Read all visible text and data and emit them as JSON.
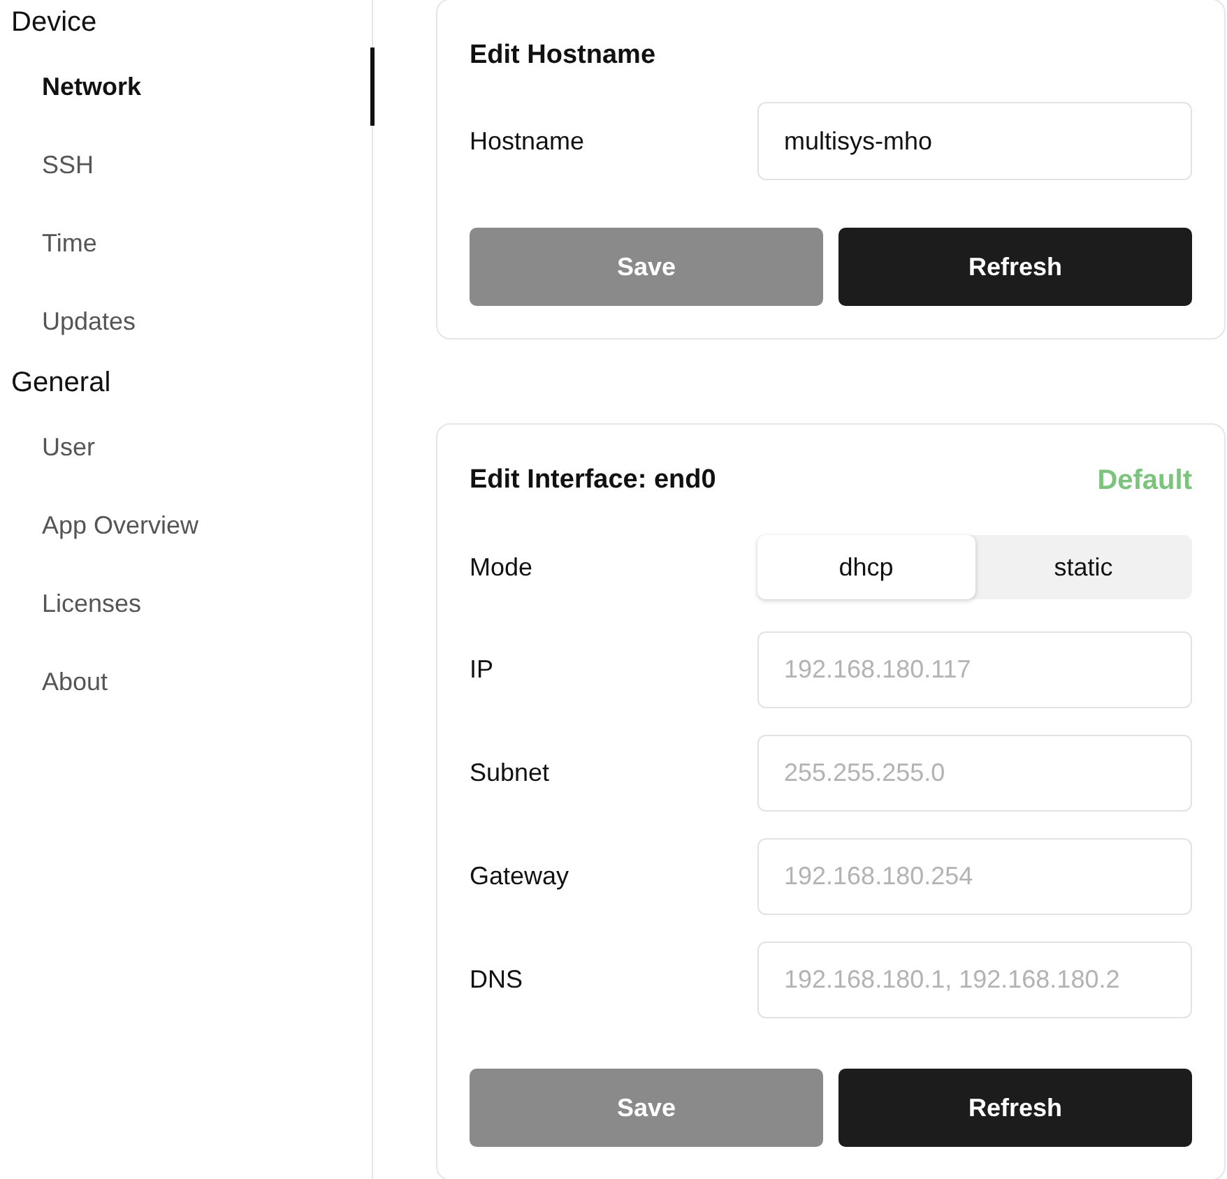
{
  "sidebar": {
    "groups": [
      {
        "title": "Device",
        "items": [
          {
            "label": "Network",
            "selected": true
          },
          {
            "label": "SSH",
            "selected": false
          },
          {
            "label": "Time",
            "selected": false
          },
          {
            "label": "Updates",
            "selected": false
          }
        ]
      },
      {
        "title": "General",
        "items": [
          {
            "label": "User",
            "selected": false
          },
          {
            "label": "App Overview",
            "selected": false
          },
          {
            "label": "Licenses",
            "selected": false
          },
          {
            "label": "About",
            "selected": false
          }
        ]
      }
    ]
  },
  "hostname_card": {
    "title": "Edit Hostname",
    "field": {
      "label": "Hostname",
      "value": "multisys-mho"
    },
    "buttons": [
      {
        "label": "Save",
        "kind": "secondary",
        "disabled": true
      },
      {
        "label": "Refresh",
        "kind": "primary",
        "disabled": false
      }
    ]
  },
  "interface_card": {
    "title": "Edit Interface: end0",
    "badge": "Default",
    "mode": {
      "label": "Mode",
      "options": [
        {
          "label": "dhcp",
          "selected": true
        },
        {
          "label": "static",
          "selected": false
        }
      ]
    },
    "fields": [
      {
        "label": "IP",
        "placeholder": "192.168.180.117"
      },
      {
        "label": "Subnet",
        "placeholder": "255.255.255.0"
      },
      {
        "label": "Gateway",
        "placeholder": "192.168.180.254"
      },
      {
        "label": "DNS",
        "placeholder": "192.168.180.1, 192.168.180.2"
      }
    ],
    "buttons": [
      {
        "label": "Save",
        "kind": "secondary",
        "disabled": true
      },
      {
        "label": "Refresh",
        "kind": "primary",
        "disabled": false
      }
    ]
  }
}
